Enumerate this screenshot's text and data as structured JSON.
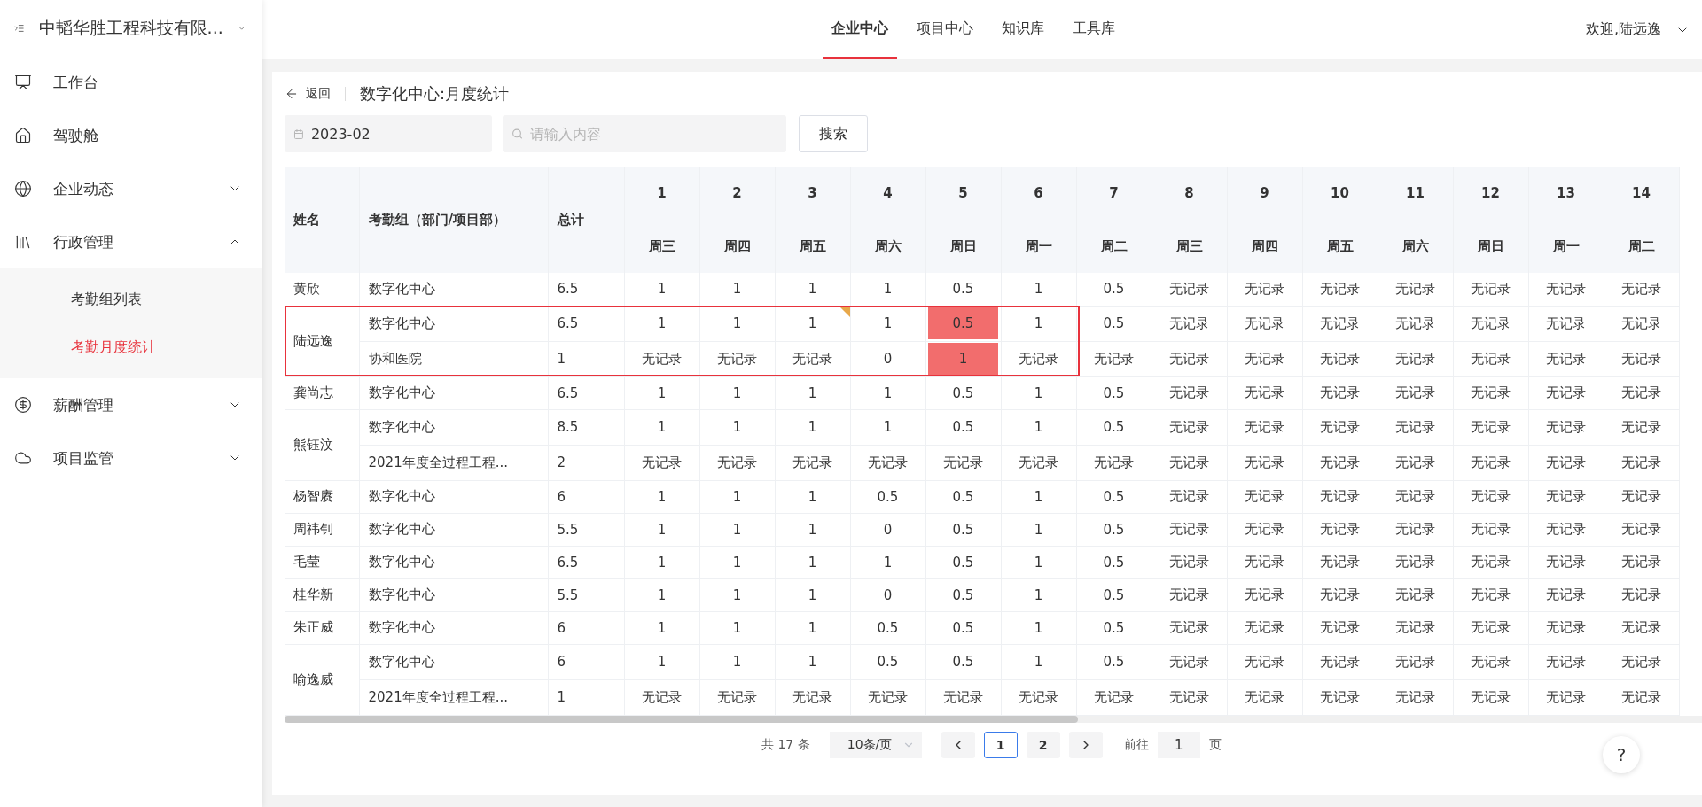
{
  "sidebar": {
    "company": "中韬华胜工程科技有限...",
    "items": [
      {
        "label": "工作台"
      },
      {
        "label": "驾驶舱"
      },
      {
        "label": "企业动态",
        "expanded": false
      },
      {
        "label": "行政管理",
        "expanded": true,
        "children": [
          {
            "label": "考勤组列表",
            "selected": false
          },
          {
            "label": "考勤月度统计",
            "selected": true
          }
        ]
      },
      {
        "label": "薪酬管理",
        "expanded": false
      },
      {
        "label": "项目监管",
        "expanded": false
      }
    ]
  },
  "top_nav": {
    "tabs": [
      {
        "label": "企业中心",
        "selected": true
      },
      {
        "label": "项目中心",
        "selected": false
      },
      {
        "label": "知识库",
        "selected": false
      },
      {
        "label": "工具库",
        "selected": false
      }
    ],
    "user": "欢迎,陆远逸"
  },
  "page": {
    "back": "返回",
    "title": "数字化中心:月度统计"
  },
  "filters": {
    "month": "2023-02",
    "search_placeholder": "请输入内容",
    "search_button": "搜索"
  },
  "table": {
    "columns": [
      "姓名",
      "考勤组（部门/项目部）",
      "总计"
    ],
    "days": [
      {
        "day": "1",
        "weekday": "周三"
      },
      {
        "day": "2",
        "weekday": "周四"
      },
      {
        "day": "3",
        "weekday": "周五"
      },
      {
        "day": "4",
        "weekday": "周六"
      },
      {
        "day": "5",
        "weekday": "周日"
      },
      {
        "day": "6",
        "weekday": "周一"
      },
      {
        "day": "7",
        "weekday": "周二"
      },
      {
        "day": "8",
        "weekday": "周三"
      },
      {
        "day": "9",
        "weekday": "周四"
      },
      {
        "day": "10",
        "weekday": "周五"
      },
      {
        "day": "11",
        "weekday": "周六"
      },
      {
        "day": "12",
        "weekday": "周日"
      },
      {
        "day": "13",
        "weekday": "周一"
      },
      {
        "day": "14",
        "weekday": "周二"
      }
    ],
    "rows": [
      {
        "name": "黄欣",
        "outlined": false,
        "groups": [
          {
            "group": "数字化中心",
            "total": "6.5",
            "values": [
              "1",
              "1",
              "1",
              "1",
              "0.5",
              "1",
              "0.5",
              "无记录",
              "无记录",
              "无记录",
              "无记录",
              "无记录",
              "无记录",
              "无记录"
            ]
          }
        ]
      },
      {
        "name": "陆远逸",
        "outlined": true,
        "groups": [
          {
            "group": "数字化中心",
            "total": "6.5",
            "values": [
              "1",
              "1",
              {
                "text": "1",
                "flagged": true,
                "highlighted": false
              },
              "1",
              {
                "text": "0.5",
                "flagged": false,
                "highlighted": true
              },
              "1",
              "0.5",
              "无记录",
              "无记录",
              "无记录",
              "无记录",
              "无记录",
              "无记录",
              "无记录"
            ]
          },
          {
            "group": "协和医院",
            "total": "1",
            "values": [
              "无记录",
              "无记录",
              "无记录",
              "0",
              {
                "text": "1",
                "flagged": false,
                "highlighted": true
              },
              "无记录",
              "无记录",
              "无记录",
              "无记录",
              "无记录",
              "无记录",
              "无记录",
              "无记录",
              "无记录"
            ]
          }
        ]
      },
      {
        "name": "龚尚志",
        "outlined": false,
        "groups": [
          {
            "group": "数字化中心",
            "total": "6.5",
            "values": [
              "1",
              "1",
              "1",
              "1",
              "0.5",
              "1",
              "0.5",
              "无记录",
              "无记录",
              "无记录",
              "无记录",
              "无记录",
              "无记录",
              "无记录"
            ]
          }
        ]
      },
      {
        "name": "熊钰汶",
        "outlined": false,
        "groups": [
          {
            "group": "数字化中心",
            "total": "8.5",
            "values": [
              "1",
              "1",
              "1",
              "1",
              "0.5",
              "1",
              "0.5",
              "无记录",
              "无记录",
              "无记录",
              "无记录",
              "无记录",
              "无记录",
              "无记录"
            ]
          },
          {
            "group": "2021年度全过程工程...",
            "total": "2",
            "values": [
              "无记录",
              "无记录",
              "无记录",
              "无记录",
              "无记录",
              "无记录",
              "无记录",
              "无记录",
              "无记录",
              "无记录",
              "无记录",
              "无记录",
              "无记录",
              "无记录"
            ]
          }
        ]
      },
      {
        "name": "杨智赓",
        "outlined": false,
        "groups": [
          {
            "group": "数字化中心",
            "total": "6",
            "values": [
              "1",
              "1",
              "1",
              "0.5",
              "0.5",
              "1",
              "0.5",
              "无记录",
              "无记录",
              "无记录",
              "无记录",
              "无记录",
              "无记录",
              "无记录"
            ]
          }
        ]
      },
      {
        "name": "周祎钊",
        "outlined": false,
        "groups": [
          {
            "group": "数字化中心",
            "total": "5.5",
            "values": [
              "1",
              "1",
              "1",
              "0",
              "0.5",
              "1",
              "0.5",
              "无记录",
              "无记录",
              "无记录",
              "无记录",
              "无记录",
              "无记录",
              "无记录"
            ]
          }
        ]
      },
      {
        "name": "毛莹",
        "outlined": false,
        "groups": [
          {
            "group": "数字化中心",
            "total": "6.5",
            "values": [
              "1",
              "1",
              "1",
              "1",
              "0.5",
              "1",
              "0.5",
              "无记录",
              "无记录",
              "无记录",
              "无记录",
              "无记录",
              "无记录",
              "无记录"
            ]
          }
        ]
      },
      {
        "name": "桂华新",
        "outlined": false,
        "groups": [
          {
            "group": "数字化中心",
            "total": "5.5",
            "values": [
              "1",
              "1",
              "1",
              "0",
              "0.5",
              "1",
              "0.5",
              "无记录",
              "无记录",
              "无记录",
              "无记录",
              "无记录",
              "无记录",
              "无记录"
            ]
          }
        ]
      },
      {
        "name": "朱正威",
        "outlined": false,
        "groups": [
          {
            "group": "数字化中心",
            "total": "6",
            "values": [
              "1",
              "1",
              "1",
              "0.5",
              "0.5",
              "1",
              "0.5",
              "无记录",
              "无记录",
              "无记录",
              "无记录",
              "无记录",
              "无记录",
              "无记录"
            ]
          }
        ]
      },
      {
        "name": "喻逸威",
        "outlined": false,
        "groups": [
          {
            "group": "数字化中心",
            "total": "6",
            "values": [
              "1",
              "1",
              "1",
              "0.5",
              "0.5",
              "1",
              "0.5",
              "无记录",
              "无记录",
              "无记录",
              "无记录",
              "无记录",
              "无记录",
              "无记录"
            ]
          },
          {
            "group": "2021年度全过程工程...",
            "total": "1",
            "values": [
              "无记录",
              "无记录",
              "无记录",
              "无记录",
              "无记录",
              "无记录",
              "无记录",
              "无记录",
              "无记录",
              "无记录",
              "无记录",
              "无记录",
              "无记录",
              "无记录"
            ]
          }
        ]
      }
    ]
  },
  "pagination": {
    "total": "共 17 条",
    "page_size": "10条/页",
    "pages": [
      {
        "label": "1",
        "selected": true
      },
      {
        "label": "2",
        "selected": false
      }
    ],
    "goto_label": "前往",
    "goto_value": "1",
    "goto_suffix": "页"
  },
  "help": "?"
}
